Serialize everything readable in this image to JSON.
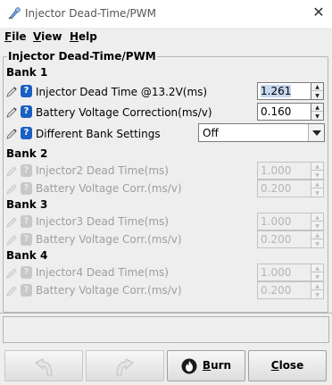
{
  "window": {
    "title": "Injector Dead-Time/PWM",
    "close_glyph": "✕",
    "icon": "app-icon"
  },
  "menu": [
    {
      "label": "File",
      "mnemonic": "F",
      "rest": "ile"
    },
    {
      "label": "View",
      "mnemonic": "V",
      "rest": "iew"
    },
    {
      "label": "Help",
      "mnemonic": "H",
      "rest": "elp"
    }
  ],
  "group_title": "Injector Dead-Time/PWM",
  "banks": [
    {
      "title": "Bank 1",
      "rows": [
        {
          "label": "Injector Dead Time @13.2V(ms)",
          "value": "1.261",
          "enabled": true,
          "selected": true
        },
        {
          "label": "Battery Voltage Correction(ms/v)",
          "value": "0.160",
          "enabled": true
        },
        {
          "label": "Different Bank Settings",
          "value": "Off",
          "enabled": true,
          "type": "combo"
        }
      ]
    },
    {
      "title": "Bank 2",
      "rows": [
        {
          "label": "Injector2 Dead Time(ms)",
          "value": "1.000",
          "enabled": false
        },
        {
          "label": "Battery Voltage Corr.(ms/v)",
          "value": "0.200",
          "enabled": false
        }
      ]
    },
    {
      "title": "Bank 3",
      "rows": [
        {
          "label": "Injector3 Dead Time(ms)",
          "value": "1.000",
          "enabled": false
        },
        {
          "label": "Battery Voltage Corr.(ms/v)",
          "value": "0.200",
          "enabled": false
        }
      ]
    },
    {
      "title": "Bank 4",
      "rows": [
        {
          "label": "Injector4 Dead Time(ms)",
          "value": "1.000",
          "enabled": false
        },
        {
          "label": "Battery Voltage Corr.(ms/v)",
          "value": "0.200",
          "enabled": false
        }
      ]
    }
  ],
  "buttons": {
    "undo_icon": "undo-icon",
    "redo_icon": "redo-icon",
    "burn": {
      "label": "Burn",
      "mnemonic": "B",
      "rest": "urn",
      "icon": "flame-icon"
    },
    "close": {
      "label": "Close",
      "mnemonic": "C",
      "rest": "lose"
    }
  },
  "colors": {
    "help_icon": "#1a5fc4",
    "panel_bg": "#eeeeee",
    "selection": "#c6d7ee"
  }
}
